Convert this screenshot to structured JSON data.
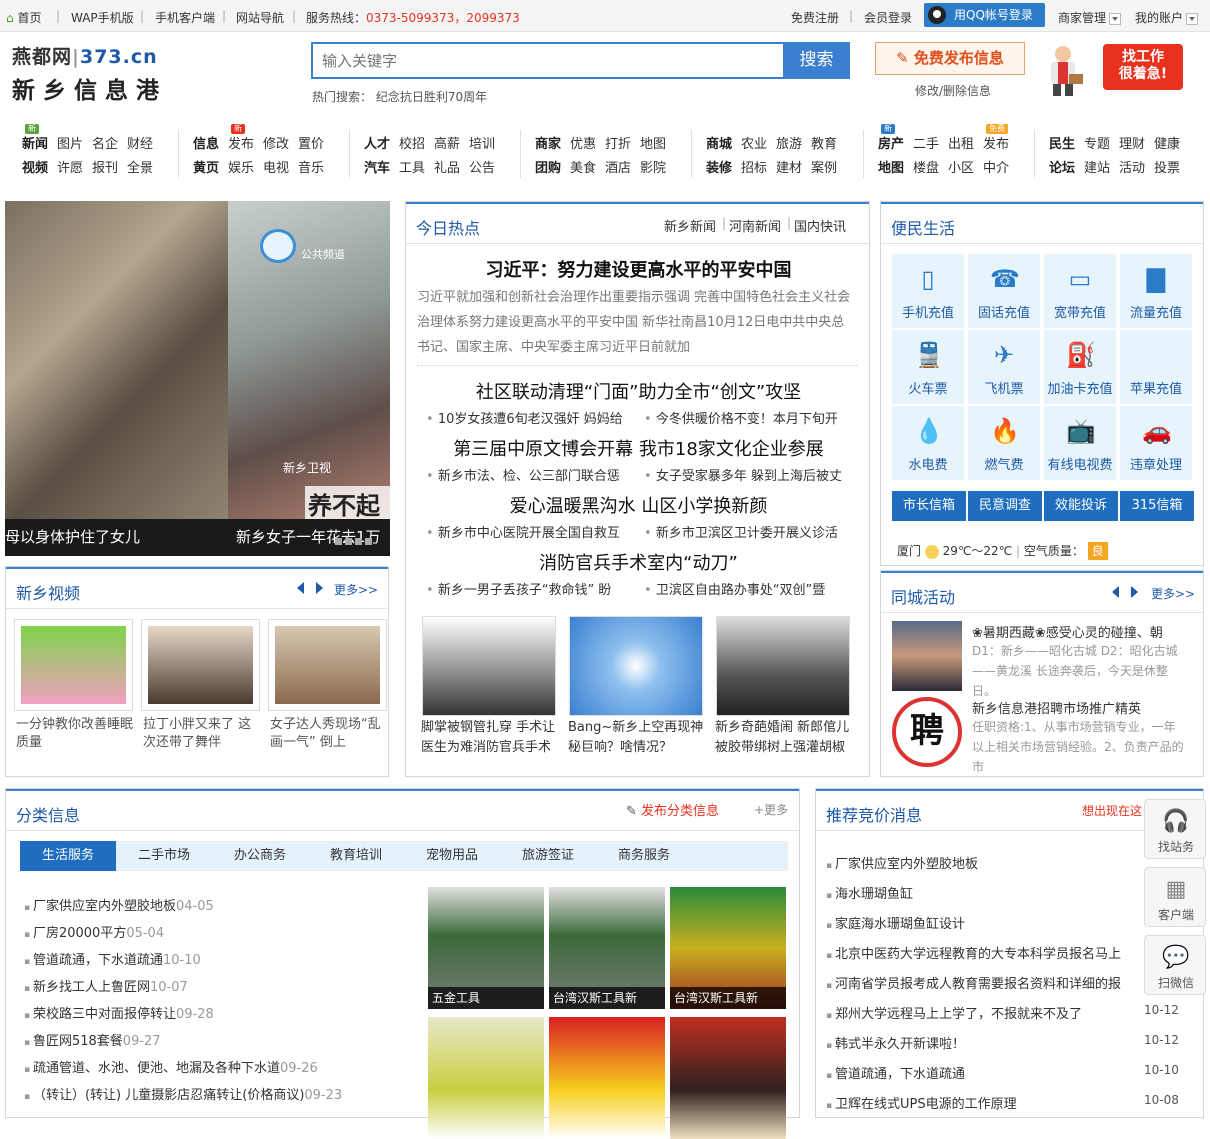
{
  "topbar": {
    "home": "首页",
    "wap": "WAP手机版",
    "client": "手机客户端",
    "sitenav": "网站导航",
    "hotline_label": "服务热线：",
    "hotline": "0373-5099373，2099373",
    "register": "免费注册",
    "login": "会员登录",
    "qq_login": "用QQ帐号登录",
    "merchant": "商家管理",
    "account": "我的账户"
  },
  "header": {
    "logo_cn": "燕都网",
    "logo_domain": "373.cn",
    "logo_sub": "新乡信息港",
    "search_placeholder": "输入关键字",
    "search_btn": "搜索",
    "hot_label": "热门搜索：",
    "hot_term": "纪念抗日胜利70周年",
    "publish": "免费发布信息",
    "edit": "修改/删除信息",
    "job_badge_1": "找工作",
    "job_badge_2": "很着急!"
  },
  "nav": {
    "groups": [
      {
        "r1": [
          "新闻",
          "图片",
          "名企",
          "财经"
        ],
        "r2": [
          "视频",
          "许愿",
          "报刊",
          "全景"
        ]
      },
      {
        "r1": [
          "信息",
          "发布",
          "修改",
          "置价"
        ],
        "r2": [
          "黄页",
          "娱乐",
          "电视",
          "音乐"
        ]
      },
      {
        "r1": [
          "人才",
          "校招",
          "高薪",
          "培训"
        ],
        "r2": [
          "汽车",
          "工具",
          "礼品",
          "公告"
        ]
      },
      {
        "r1": [
          "商家",
          "优惠",
          "打折",
          "地图"
        ],
        "r2": [
          "团购",
          "美食",
          "酒店",
          "影院"
        ]
      },
      {
        "r1": [
          "商城",
          "农业",
          "旅游",
          "教育"
        ],
        "r2": [
          "装修",
          "招标",
          "建材",
          "案例"
        ]
      },
      {
        "r1": [
          "房产",
          "二手",
          "出租",
          "发布"
        ],
        "r2": [
          "地图",
          "楼盘",
          "小区",
          "中介"
        ]
      },
      {
        "r1": [
          "民生",
          "专题",
          "理财",
          "健康"
        ],
        "r2": [
          "论坛",
          "建站",
          "活动",
          "投票"
        ]
      }
    ],
    "tags": {
      "new": "新",
      "free": "免费"
    }
  },
  "slide": {
    "caption_left": "母以身体护住了女儿",
    "caption_right": "新乡女子一年花去1万",
    "overlay": "养不起的",
    "watermark": "新乡卫视",
    "channel": "公共频道"
  },
  "hot": {
    "title": "今日热点",
    "tabs": [
      "新乡新闻",
      "河南新闻",
      "国内快讯"
    ],
    "headline": "习近平：努力建设更高水平的平安中国",
    "summary": "习近平就加强和创新社会治理作出重要指示强调 完善中国特色社会主义社会治理体系努力建设更高水平的平安中国 新华社南昌10月12日电中共中央总书记、国家主席、中央军委主席习近平日前就加",
    "items": [
      {
        "main": "社区联动清理“门面”助力全市“创文”攻坚",
        "subs": [
          "10岁女孩遭6旬老汉强奸 妈妈给",
          "今冬供暖价格不变！本月下旬开"
        ]
      },
      {
        "main": "第三届中原文博会开幕 我市18家文化企业参展",
        "subs": [
          "新乡市法、检、公三部门联合惩",
          "女子受家暴多年 躲到上海后被丈"
        ]
      },
      {
        "main": "爱心温暖黑沟水 山区小学换新颜",
        "subs": [
          "新乡市中心医院开展全国自救互",
          "新乡市卫滨区卫计委开展义诊活"
        ]
      },
      {
        "main": "消防官兵手术室内“动刀”",
        "subs": [
          "新乡一男子丢孩子“救命钱” 盼",
          "卫滨区自由路办事处“双创”暨"
        ]
      }
    ],
    "pics": [
      "脚掌被钢管扎穿 手术让医生为难消防官兵手术",
      "Bang~新乡上空再现神秘巨响？啥情况？",
      "新乡奇葩婚闹 新郎倌儿被胶带绑树上强灌胡椒"
    ]
  },
  "life": {
    "title": "便民生活",
    "cells": [
      {
        "label": "手机充值",
        "icon": "phone-icon"
      },
      {
        "label": "固话充值",
        "icon": "landline-icon"
      },
      {
        "label": "宽带充值",
        "icon": "router-icon"
      },
      {
        "label": "流量充值",
        "icon": "signal-icon"
      },
      {
        "label": "火车票",
        "icon": "train-icon"
      },
      {
        "label": "飞机票",
        "icon": "plane-icon"
      },
      {
        "label": "加油卡充值",
        "icon": "fuel-icon"
      },
      {
        "label": "苹果充值",
        "icon": "apple-icon"
      },
      {
        "label": "水电费",
        "icon": "water-icon"
      },
      {
        "label": "燃气费",
        "icon": "flame-icon"
      },
      {
        "label": "有线电视费",
        "icon": "tv-icon"
      },
      {
        "label": "违章处理",
        "icon": "car-icon"
      }
    ],
    "buttons": [
      "市长信箱",
      "民意调查",
      "效能投诉",
      "315信箱"
    ],
    "weather_city": "厦门",
    "weather_temp": "29℃～22℃",
    "air_label": "空气质量：",
    "air_value": "良"
  },
  "activity": {
    "title": "同城活动",
    "more": "更多>>",
    "items": [
      {
        "title": "❀暑期西藏❀感受心灵的碰撞、朝",
        "desc": "D1：新乡——昭化古城 D2：昭化古城——黄龙溪 长途奔袭后，今天是休整日。"
      },
      {
        "title": "新乡信息港招聘市场推广精英",
        "desc": "任职资格:1、从事市场营销专业，一年以上相关市场营销经验。2、负责产品的市",
        "img_text": "聘"
      }
    ]
  },
  "video": {
    "title": "新乡视频",
    "more": "更多>>",
    "items": [
      "一分钟教你改善睡眠质量",
      "拉丁小胖又来了 这次还带了舞伴",
      "女子达人秀现场“乱画一气” 倒上"
    ]
  },
  "classified": {
    "title": "分类信息",
    "publish": "发布分类信息",
    "more": "+更多",
    "tabs": [
      "生活服务",
      "二手市场",
      "办公商务",
      "教育培训",
      "宠物用品",
      "旅游签证",
      "商务服务"
    ],
    "items": [
      {
        "t": "厂家供应室内外塑胶地板",
        "d": "04-05"
      },
      {
        "t": "厂房20000平方",
        "d": "05-04"
      },
      {
        "t": "管道疏通，下水道疏通",
        "d": "10-10"
      },
      {
        "t": "新乡找工人上鲁匠网",
        "d": "10-07"
      },
      {
        "t": "荣校路三中对面报停转让",
        "d": "09-28"
      },
      {
        "t": "鲁匠网518套餐",
        "d": "09-27"
      },
      {
        "t": "疏通管道、水池、便池、地漏及各种下水道",
        "d": "09-26"
      },
      {
        "t": "（转让）(转让) 儿童摄影店忍痛转让(价格商议)",
        "d": "09-23"
      }
    ],
    "gallery": [
      "五金工具",
      "台湾汉斯工具新",
      "台湾汉斯工具新"
    ]
  },
  "recommend": {
    "title": "推荐竞价消息",
    "want": "想出现在这",
    "items": [
      {
        "t": "厂家供应室内外塑胶地板",
        "d": "04-05"
      },
      {
        "t": "海水珊瑚鱼缸",
        "d": ""
      },
      {
        "t": "家庭海水珊瑚鱼缸设计",
        "d": ""
      },
      {
        "t": "北京中医药大学远程教育的大专本科学员报名马上",
        "d": ""
      },
      {
        "t": "河南省学员报考成人教育需要报名资料和详细的报",
        "d": ""
      },
      {
        "t": "郑州大学远程马上上学了，不报就来不及了",
        "d": "10-12"
      },
      {
        "t": "韩式半永久开新课啦！",
        "d": "10-12"
      },
      {
        "t": "管道疏通，下水道疏通",
        "d": "10-10"
      },
      {
        "t": "卫辉在线式UPS电源的工作原理",
        "d": "10-08"
      }
    ]
  },
  "float": [
    "找站务",
    "客户端",
    "扫微信"
  ]
}
